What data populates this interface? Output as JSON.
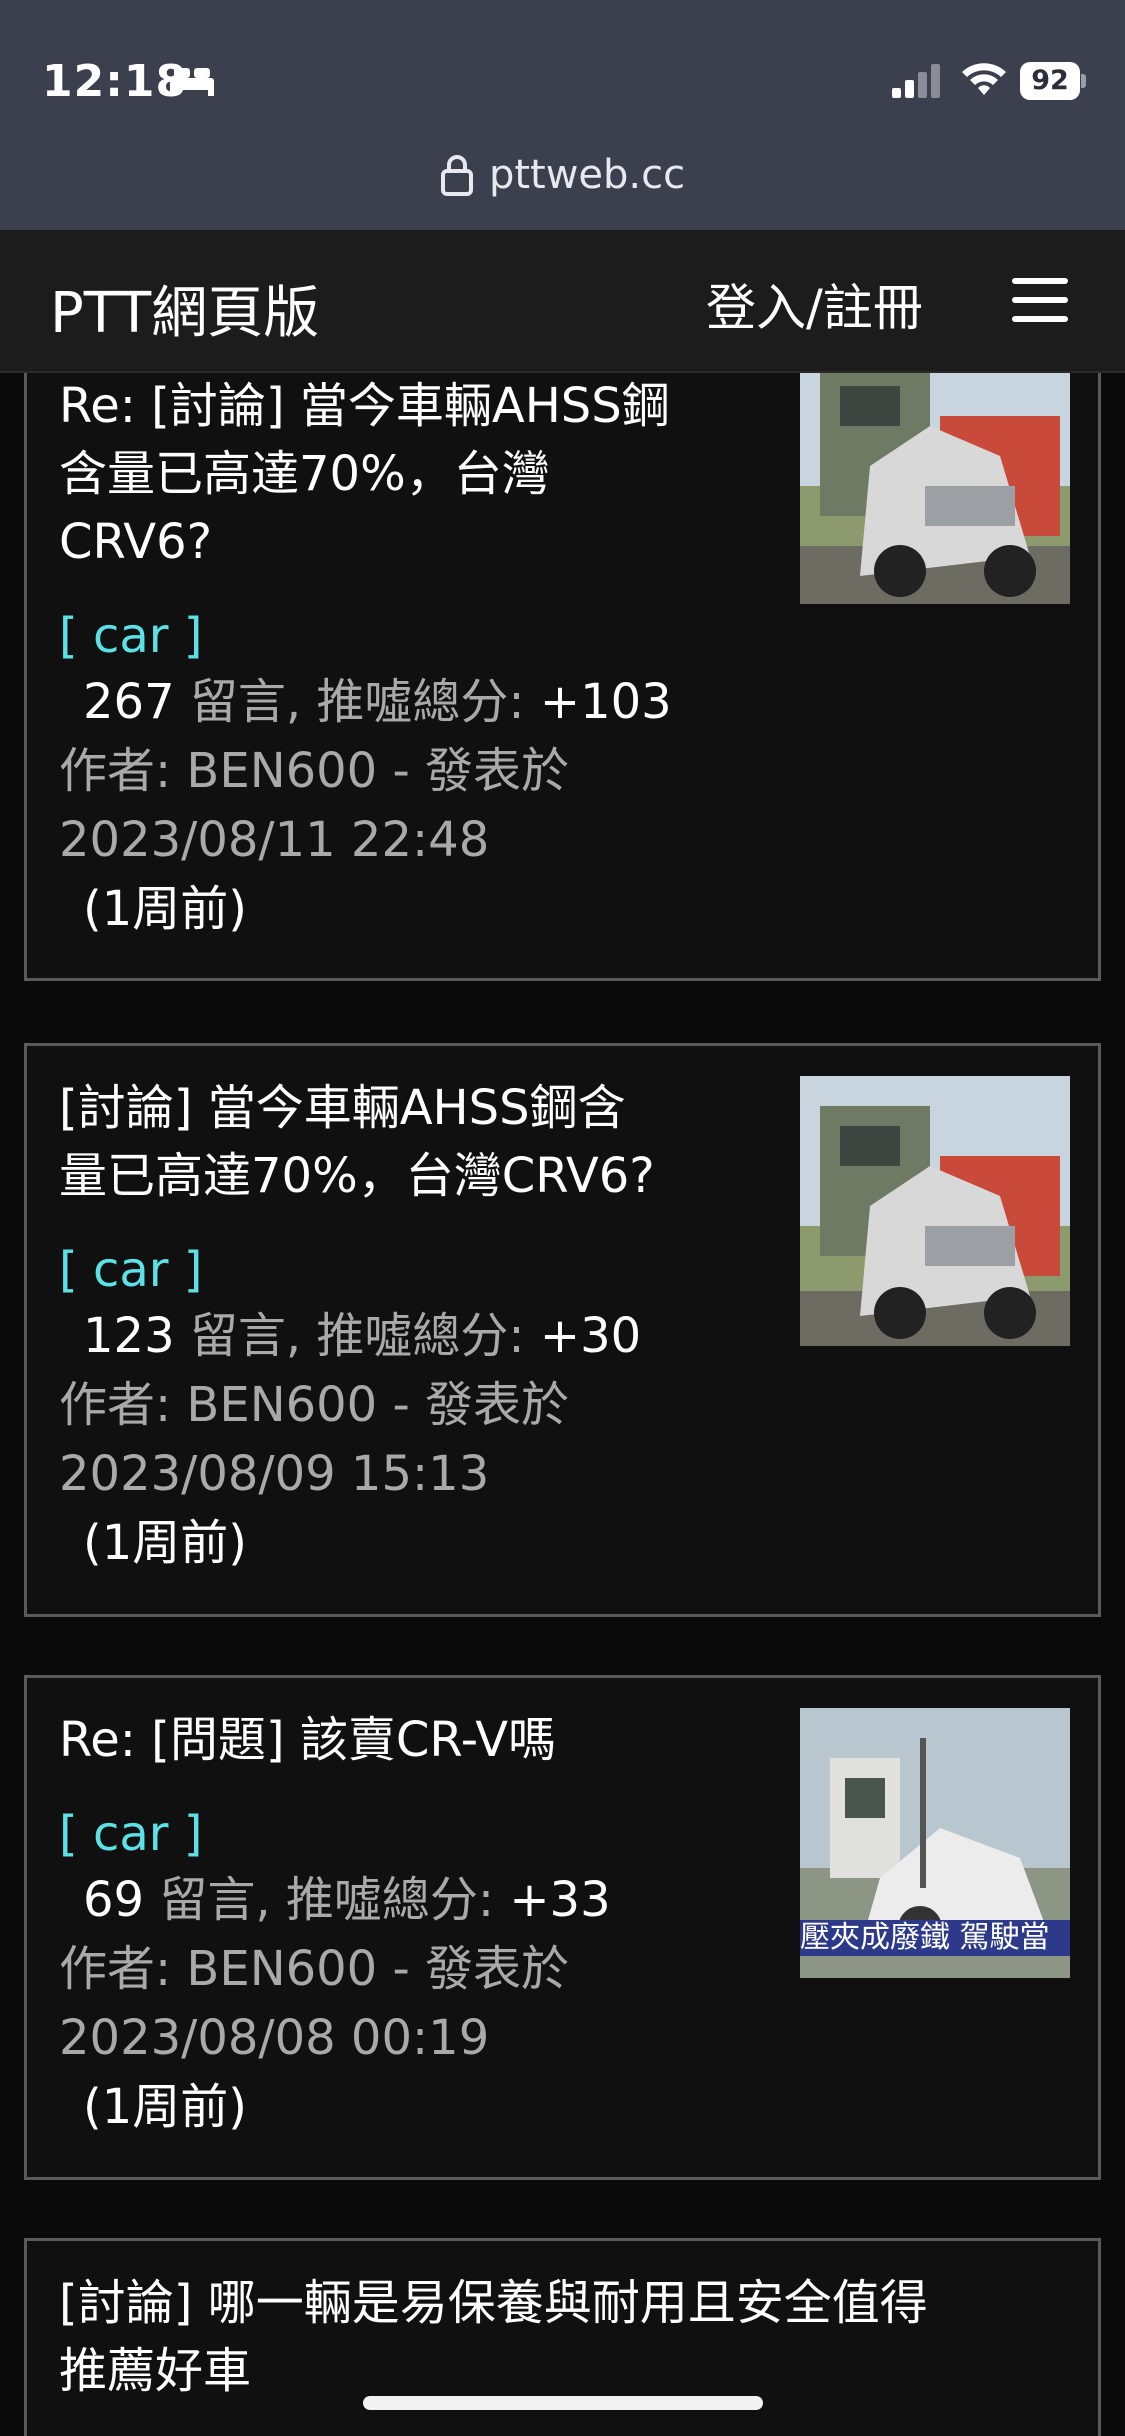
{
  "status_bar": {
    "time": "12:18",
    "battery": "92"
  },
  "browser": {
    "url": "pttweb.cc"
  },
  "navbar": {
    "brand": "PTT網頁版",
    "login": "登入/註冊"
  },
  "posts": [
    {
      "title": "Re: [討論] 當今車輛AHSS鋼含量已高達70%，台灣CRV6?",
      "title_lines": [
        "Re: [討論] 當今車輛AHSS鋼",
        "含量已高達70%，台灣",
        "CRV6?"
      ],
      "board": "[ car ]",
      "comments": "267",
      "comments_label": "留言, 推噓總分:",
      "score": "+103",
      "author_line": "作者: BEN600 - 發表於",
      "datetime": "2023/08/11 22:48",
      "ago": "(1周前)"
    },
    {
      "title": "[討論] 當今車輛AHSS鋼含量已高達70%，台灣CRV6?",
      "title_lines": [
        "[討論] 當今車輛AHSS鋼含",
        "量已高達70%，台灣CRV6?"
      ],
      "board": "[ car ]",
      "comments": "123",
      "comments_label": "留言, 推噓總分:",
      "score": "+30",
      "author_line": "作者: BEN600 - 發表於",
      "datetime": "2023/08/09 15:13",
      "ago": "(1周前)"
    },
    {
      "title": "Re: [問題] 該賣CR-V嗎",
      "title_lines": [
        "Re: [問題] 該賣CR-V嗎"
      ],
      "board": "[ car ]",
      "comments": "69",
      "comments_label": "留言, 推噓總分:",
      "score": "+33",
      "author_line": "作者: BEN600 - 發表於",
      "datetime": "2023/08/08 00:19",
      "ago": "(1周前)",
      "thumb_caption": "壓夾成廢鐵 駕駛當"
    },
    {
      "title": "[討論] 哪一輛是易保養與耐用且安全值得推薦好車",
      "title_lines": [
        "[討論] 哪一輛是易保養與耐用且安全值得",
        "推薦好車"
      ]
    }
  ]
}
